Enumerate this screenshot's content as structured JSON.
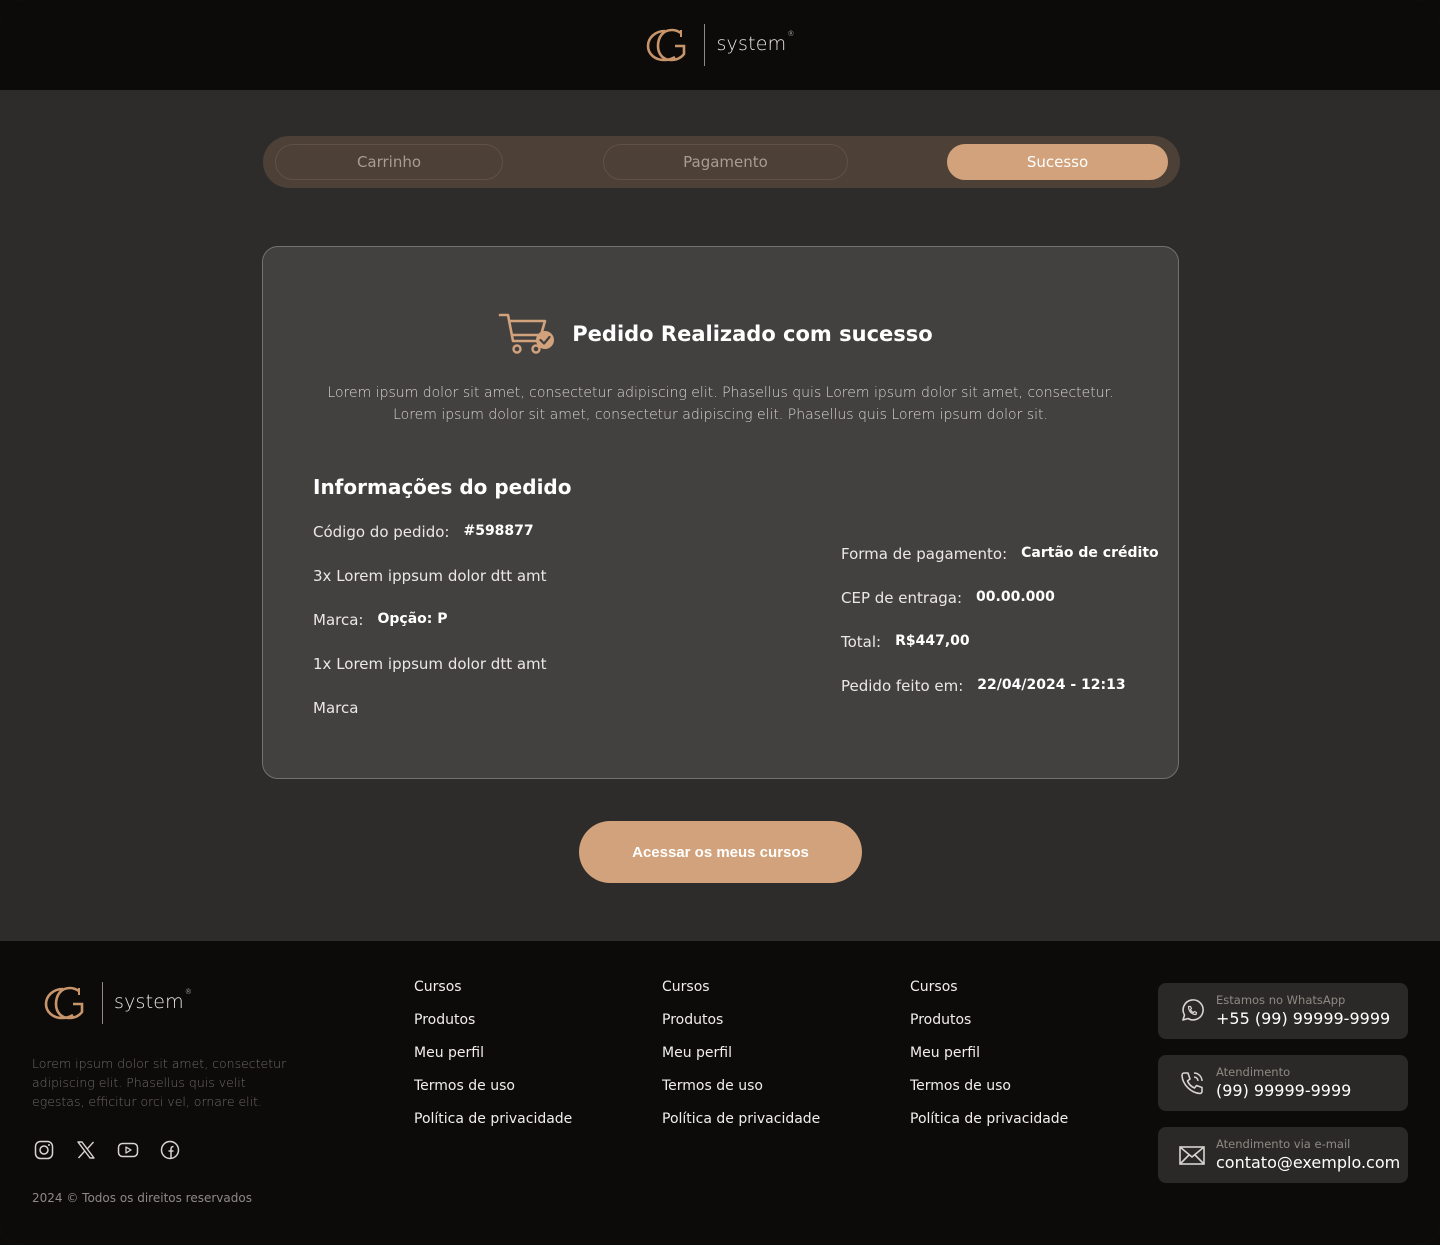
{
  "brand": {
    "word": "system",
    "reg": "®"
  },
  "steps": [
    {
      "label": "Carrinho"
    },
    {
      "label": "Pagamento"
    },
    {
      "label": "Sucesso"
    }
  ],
  "card": {
    "title": "Pedido Realizado com sucesso",
    "lead_line1": "Lorem ipsum dolor sit amet, consectetur adipiscing elit. Phasellus quis Lorem ipsum dolor sit amet, consectetur.",
    "lead_line2": "Lorem ipsum dolor sit amet, consectetur adipiscing elit. Phasellus quis Lorem ipsum dolor sit.",
    "section_title": "Informações do pedido",
    "left": {
      "code_label": "Código do pedido:",
      "code_value": "#598877",
      "item1": "3x Lorem ippsum dolor dtt amt",
      "brand_label": "Marca:",
      "brand_value": "Opção: P",
      "item2": "1x Lorem ippsum dolor dtt amt",
      "brand2_label": "Marca"
    },
    "right": {
      "payment_label": "Forma de pagamento:",
      "payment_value": "Cartão de crédito",
      "cep_label": "CEP de entraga:",
      "cep_value": "00.00.000",
      "total_label": "Total:",
      "total_value": "R$447,00",
      "date_label": "Pedido feito em:",
      "date_value": "22/04/2024 - 12:13"
    }
  },
  "cta": {
    "label": "Acessar os meus cursos"
  },
  "footer": {
    "description": "Lorem ipsum dolor sit amet, consectetur adipiscing elit. Phasellus quis velit egestas, efficitur orci vel, ornare elit.",
    "copyright": "2024 © Todos os direitos reservados",
    "link_columns": [
      [
        "Cursos",
        "Produtos",
        "Meu perfil",
        "Termos de uso",
        "Política de privacidade"
      ],
      [
        "Cursos",
        "Produtos",
        "Meu perfil",
        "Termos de uso",
        "Política de privacidade"
      ],
      [
        "Cursos",
        "Produtos",
        "Meu perfil",
        "Termos de uso",
        "Política de privacidade"
      ]
    ],
    "socials": [
      "instagram-icon",
      "x-icon",
      "youtube-icon",
      "facebook-icon"
    ],
    "contacts": [
      {
        "icon": "whatsapp-icon",
        "label": "Estamos no WhatsApp",
        "value": "+55 (99) 99999-9999"
      },
      {
        "icon": "phone-icon",
        "label": "Atendimento",
        "value": "(99) 99999-9999"
      },
      {
        "icon": "mail-icon",
        "label": "Atendimento via e-mail",
        "value": "contato@exemplo.com"
      }
    ]
  },
  "colors": {
    "accent": "#d1a27b",
    "background": "#2d2c2b",
    "card": "#424140",
    "header": "#0c0b0a"
  }
}
